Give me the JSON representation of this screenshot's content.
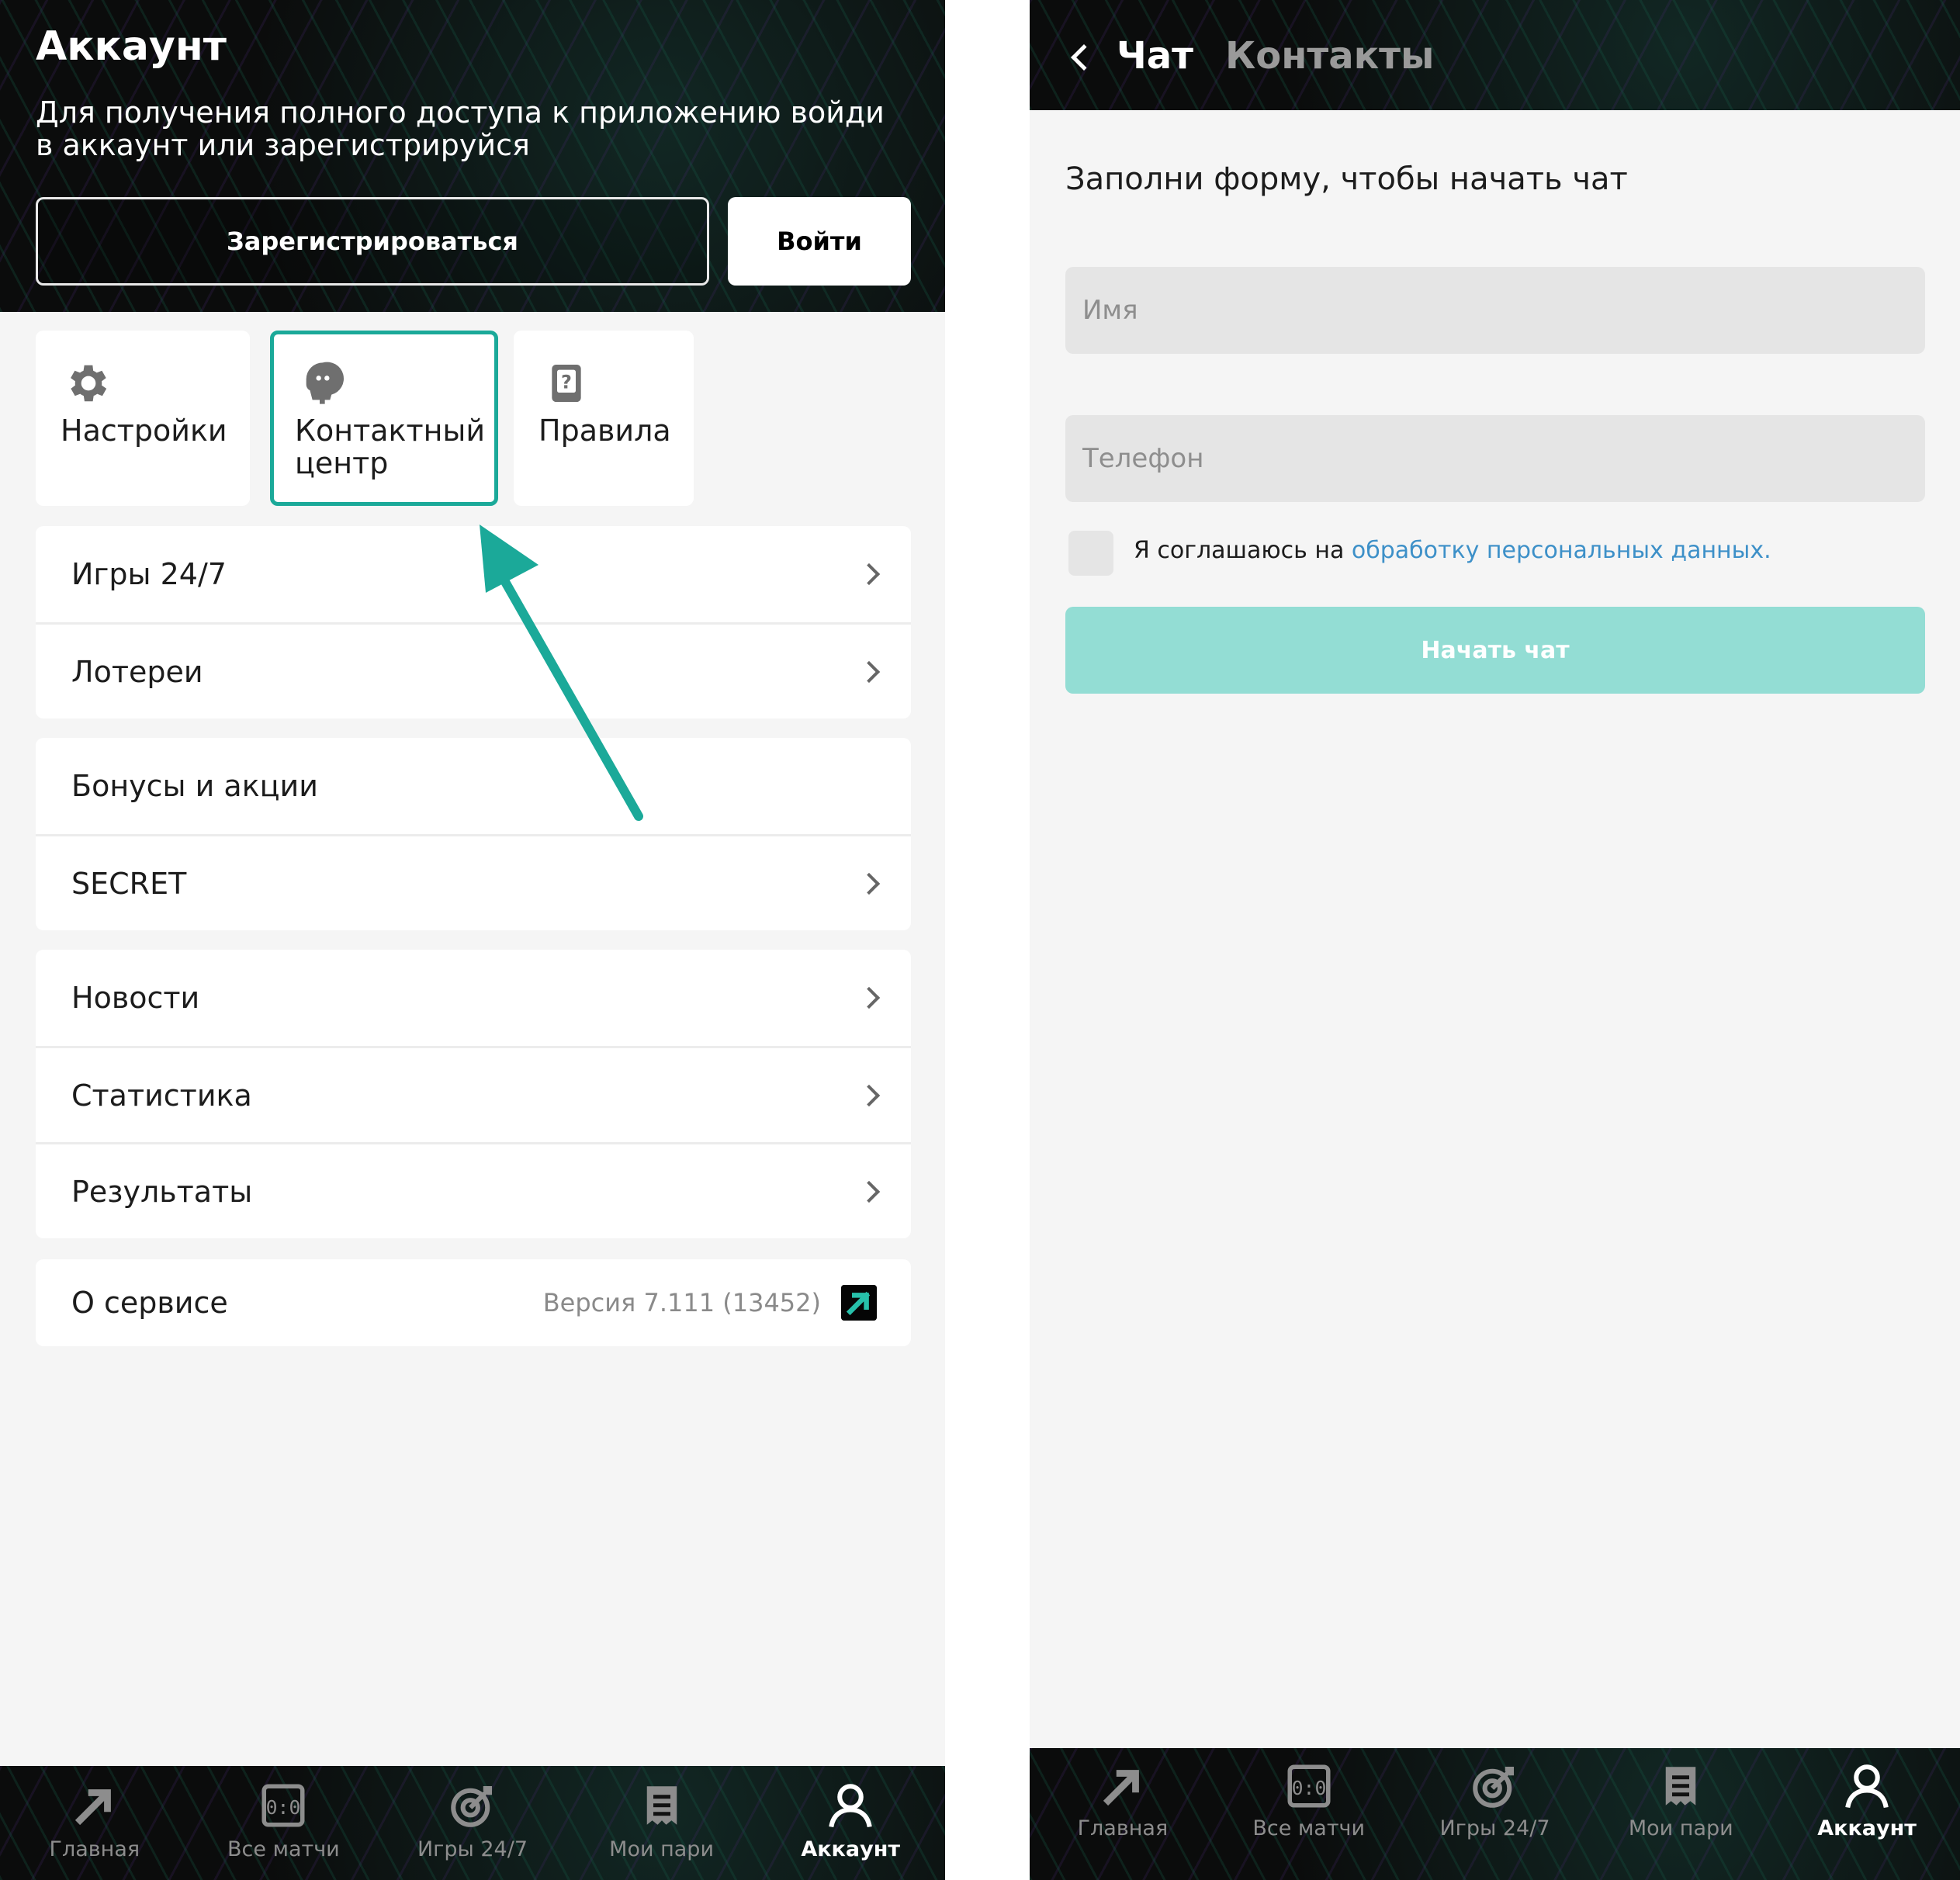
{
  "left": {
    "header": {
      "title": "Аккаунт",
      "subtitle": "Для получения полного доступа к приложению войди в аккаунт или зарегистрируйся",
      "register_label": "Зарегистрироваться",
      "login_label": "Войти"
    },
    "tiles": [
      {
        "label": "Настройки",
        "icon": "gear-icon"
      },
      {
        "label": "Контактный центр",
        "icon": "headset-chat-icon",
        "highlighted": true
      },
      {
        "label": "Правила",
        "icon": "rules-book-icon"
      }
    ],
    "list_groups": [
      [
        {
          "label": "Игры 24/7",
          "chevron": true
        },
        {
          "label": "Лотереи",
          "chevron": true
        }
      ],
      [
        {
          "label": "Бонусы и акции",
          "chevron": false
        },
        {
          "label": "SECRET",
          "chevron": true
        }
      ],
      [
        {
          "label": "Новости",
          "chevron": true
        },
        {
          "label": "Статистика",
          "chevron": true
        },
        {
          "label": "Результаты",
          "chevron": true
        }
      ],
      [
        {
          "label": "О сервисе",
          "version": "Версия 7.111 (13452)"
        }
      ]
    ],
    "annotation": {
      "color": "#1ba999",
      "points_to": "Контактный центр"
    }
  },
  "right": {
    "header": {
      "tab_active": "Чат",
      "tab_inactive": "Контакты"
    },
    "form": {
      "title": "Заполни форму, чтобы начать чат",
      "name_placeholder": "Имя",
      "phone_placeholder": "Телефон",
      "consent_text": "Я соглашаюсь на ",
      "consent_link": "обработку персональных данных.",
      "submit_label": "Начать чат"
    }
  },
  "bottom_nav": [
    {
      "label": "Главная",
      "icon": "home-arrow-icon"
    },
    {
      "label": "Все матчи",
      "icon": "scoreboard-icon"
    },
    {
      "label": "Игры 24/7",
      "icon": "target-icon"
    },
    {
      "label": "Мои пари",
      "icon": "bets-list-icon"
    },
    {
      "label": "Аккаунт",
      "icon": "user-icon",
      "active": true
    }
  ],
  "colors": {
    "accent": "#1ba999",
    "button_disabled": "#93ddd4",
    "link": "#3d90c8",
    "header_bg": "#0b0c0c",
    "page_bg": "#f5f5f5"
  }
}
